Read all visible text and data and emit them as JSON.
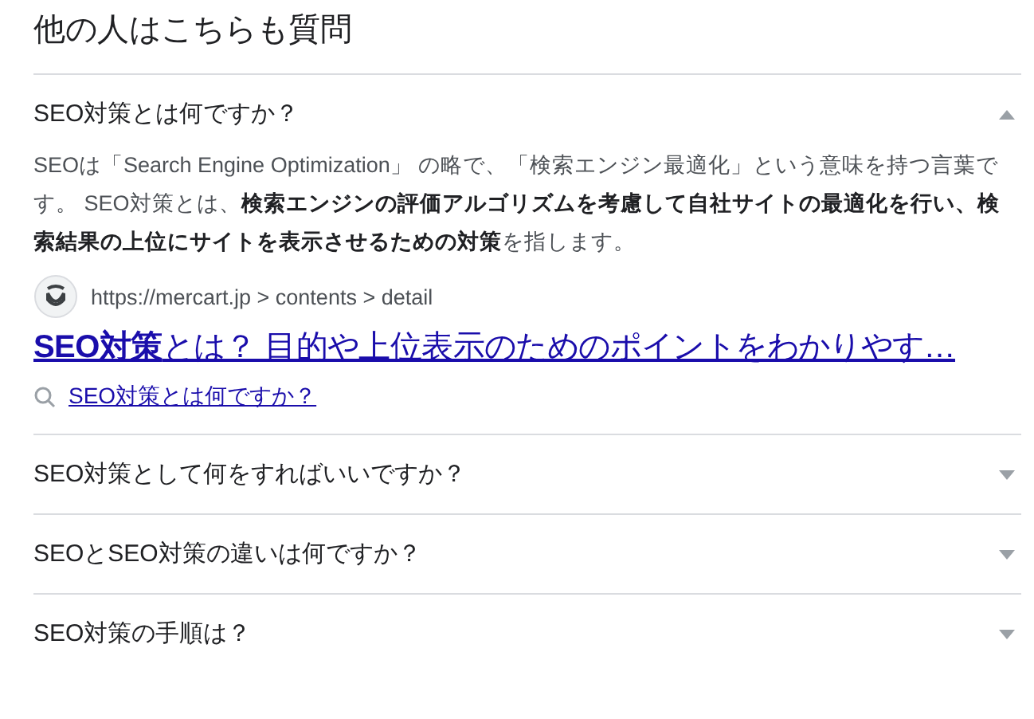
{
  "heading": "他の人はこちらも質問",
  "questions": [
    {
      "question": "SEO対策とは何ですか？",
      "expanded": true,
      "answer": {
        "text": "SEOは「Search Engine Optimization」 の略で、「検索エンジン最適化」という意味を持つ言葉です。 SEO対策とは、**検索エンジンの評価アルゴリズムを考慮して自社サイトの最適化を行い、検索結果の上位にサイトを表示させるための対策**を指します。",
        "source_url": "https://mercart.jp > contents > detail",
        "link_title": "**SEO対策**とは？ 目的や上位表示のためのポイントをわかりやす…",
        "search_link": "SEO対策とは何ですか？"
      }
    },
    {
      "question": "SEO対策として何をすればいいですか？",
      "expanded": false
    },
    {
      "question": "SEOとSEO対策の違いは何ですか？",
      "expanded": false
    },
    {
      "question": "SEO対策の手順は？",
      "expanded": false
    }
  ]
}
